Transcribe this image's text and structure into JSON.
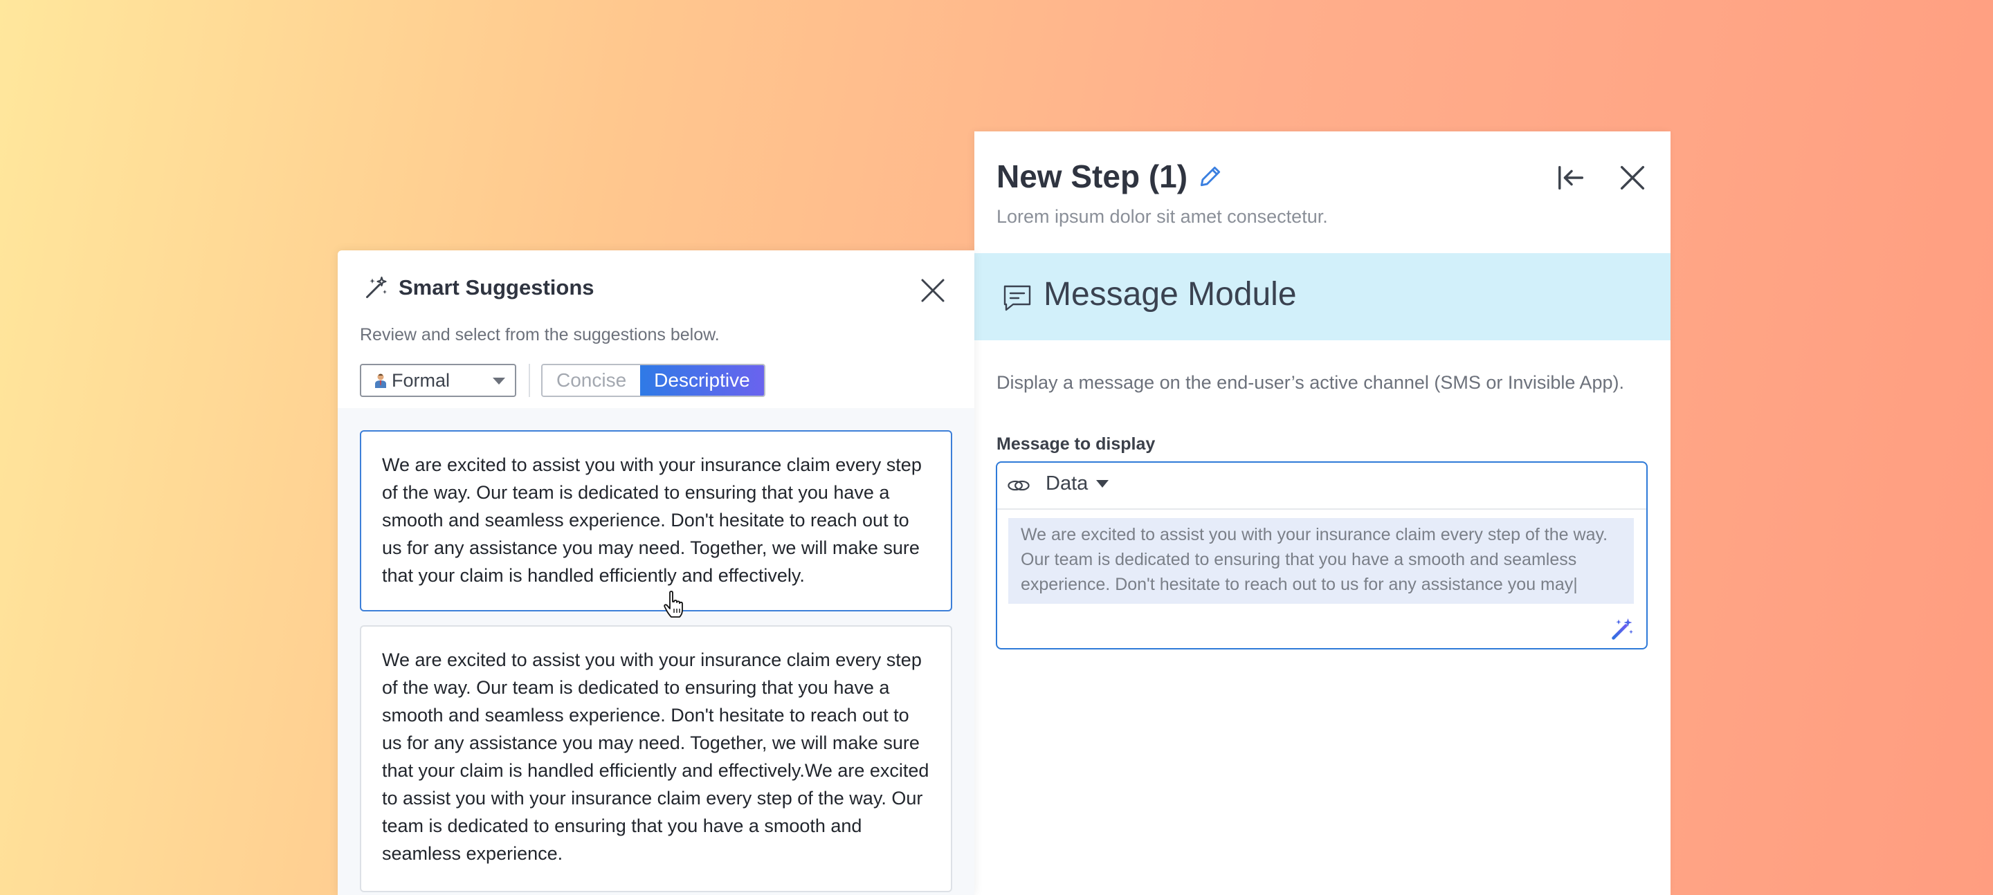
{
  "step_panel": {
    "title": "New Step (1)",
    "subtitle": "Lorem ipsum dolor sit amet consectetur.",
    "icons": {
      "edit": "pencil-icon",
      "collapse": "collapse-left-icon",
      "close": "close-icon"
    },
    "module": {
      "title": "Message Module",
      "icon": "chat-bubble-icon",
      "description": "Display a message on the end-user’s active channel (SMS or Invisible App).",
      "field_label": "Message to display",
      "data_dropdown": "Data",
      "message_text": "We are excited to assist you with your insurance claim every step of the way. Our team is dedicated to ensuring that you have a smooth and seamless experience. Don't hesitate to reach out to us for any assistance you may|"
    }
  },
  "smart_suggestions": {
    "title": "Smart Suggestions",
    "description": "Review and select from the suggestions below.",
    "tone": "Formal",
    "length_options": [
      {
        "label": "Concise",
        "active": false
      },
      {
        "label": "Descriptive",
        "active": true
      }
    ],
    "suggestions": [
      {
        "text": "We are excited to assist you with your insurance claim every step of the way. Our team is dedicated to ensuring that you have a smooth and seamless experience. Don't hesitate to reach out to us for any assistance you may need. Together, we will make sure that your claim is handled efficiently and effectively."
      },
      {
        "text": "We are excited to assist you with your insurance claim every step of the way. Our team is dedicated to ensuring that you have a smooth and seamless experience. Don't hesitate to reach out to us for any assistance you may need. Together, we will make sure that your claim is handled efficiently and effectively.We are excited to assist you with your insurance claim every step of the way. Our team is dedicated to ensuring that you have a smooth and seamless experience."
      }
    ]
  },
  "colors": {
    "accent": "#2f7ad8",
    "banner": "#d2f0fa",
    "gradient_start": "#ffe79c",
    "gradient_end": "#ff9d80"
  }
}
